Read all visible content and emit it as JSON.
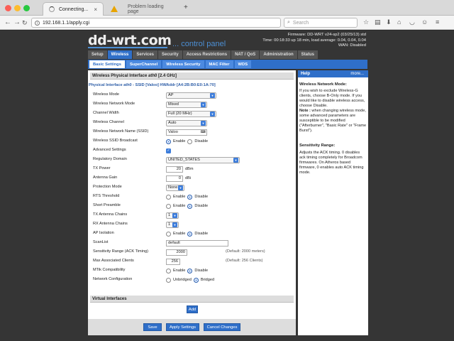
{
  "browser": {
    "tabs": [
      {
        "label": "Connecting..."
      },
      {
        "label": "Problem loading page"
      }
    ],
    "url": "192.168.1.1/apply.cgi",
    "search_placeholder": "Search"
  },
  "header": {
    "logo": "dd-wrt.com",
    "logo_sub": "... control panel",
    "firmware": "Firmware: DD-WRT v24-sp2 (03/25/13) std",
    "time": "Time: 00:18:33 up 18 min, load average: 0.04, 0.04, 0.04",
    "wan": "WAN: Disabled"
  },
  "main_menu": [
    "Setup",
    "Wireless",
    "Services",
    "Security",
    "Access Restrictions",
    "NAT / QoS",
    "Administration",
    "Status"
  ],
  "sub_menu": [
    "Basic Settings",
    "SuperChannel",
    "Wireless Security",
    "MAC Filter",
    "WDS"
  ],
  "section_title": "Wireless Physical Interface ath0 [2.4 GHz]",
  "interface_line": "Physical Interface ath0 - SSID [Valoo] HWAddr [A4:2B:B0:E0:1A:70]",
  "fields": {
    "wireless_mode": {
      "label": "Wireless Mode",
      "value": "AP"
    },
    "network_mode": {
      "label": "Wireless Network Mode",
      "value": "Mixed"
    },
    "channel_width": {
      "label": "Channel Width",
      "value": "Full (20 MHz)"
    },
    "channel": {
      "label": "Wireless Channel",
      "value": "Auto"
    },
    "ssid": {
      "label": "Wireless Network Name (SSID)",
      "value": "Valoo"
    },
    "ssid_broadcast": {
      "label": "Wireless SSID Broadcast",
      "opt1": "Enable",
      "opt2": "Disable"
    },
    "advanced": {
      "label": "Advanced Settings"
    },
    "reg_domain": {
      "label": "Regulatory Domain",
      "value": "UNITED_STATES"
    },
    "tx_power": {
      "label": "TX Power",
      "value": "20",
      "unit": "dBm"
    },
    "antenna_gain": {
      "label": "Antenna Gain",
      "value": "0",
      "unit": "dBi"
    },
    "protection": {
      "label": "Protection Mode",
      "value": "None"
    },
    "rts": {
      "label": "RTS Threshold",
      "opt1": "Enable",
      "opt2": "Disable"
    },
    "preamble": {
      "label": "Short Preamble",
      "opt1": "Enable",
      "opt2": "Disable"
    },
    "tx_chains": {
      "label": "TX Antenna Chains",
      "value": "1"
    },
    "rx_chains": {
      "label": "RX Antenna Chains",
      "value": "1"
    },
    "ap_isolation": {
      "label": "AP Isolation",
      "opt1": "Enable",
      "opt2": "Disable"
    },
    "scanlist": {
      "label": "ScanList",
      "value": "default"
    },
    "sens_range": {
      "label": "Sensitivity Range (ACK Timing)",
      "value": "2000",
      "note": "(Default: 2000 meters)"
    },
    "max_clients": {
      "label": "Max Associated Clients",
      "value": "256",
      "note": "(Default: 256 Clients)"
    },
    "mtik": {
      "label": "MTik Compatibility",
      "opt1": "Enable",
      "opt2": "Disable"
    },
    "net_config": {
      "label": "Network Configuration",
      "opt1": "Unbridged",
      "opt2": "Bridged"
    }
  },
  "virtual_title": "Virtual Interfaces",
  "buttons": {
    "add": "Add",
    "save": "Save",
    "apply": "Apply Settings",
    "cancel": "Cancel Changes"
  },
  "help": {
    "title": "Help",
    "more": "more...",
    "h1": "Wireless Network Mode:",
    "t1": "If you wish to exclude Wireless-G clients, choose B-Only mode. If you would like to disable wireless access, choose Disable.",
    "t1b_label": "Note :",
    "t1b": " when changing wireless mode, some advanced parameters are susceptible to be modified (\"Afterburner\", \"Basic Rate\" or \"Frame Burst\").",
    "h2": "Sensitivity Range:",
    "t2": "Adjusts the ACK timing. 0 disables ack timing completely for Broadcom firmwares. On Atheros based firmware, 0 enables auto ACK timing mode."
  },
  "colors": {
    "accent": "#2f6fc9",
    "page_bg": "#353535"
  }
}
